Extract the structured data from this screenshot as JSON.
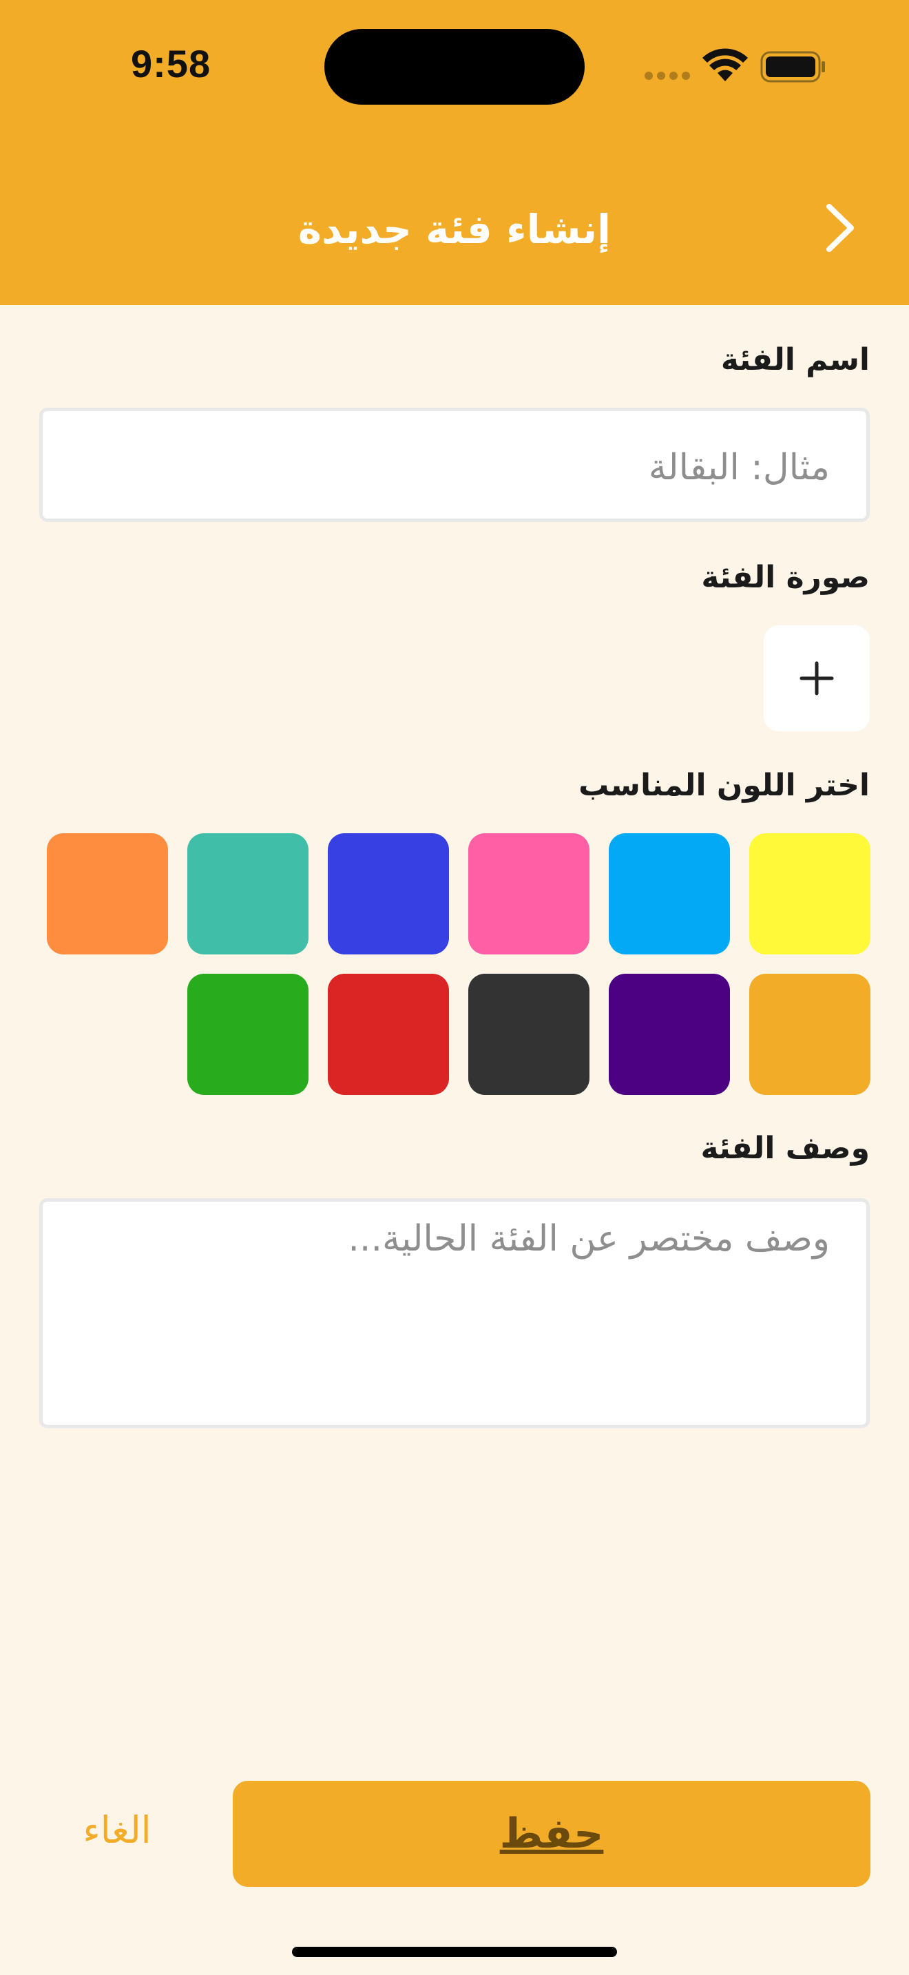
{
  "status_bar": {
    "time": "9:58"
  },
  "header": {
    "title": "إنشاء فئة جديدة",
    "back_icon": "chevron-right-icon"
  },
  "form": {
    "name_label": "اسم الفئة",
    "name_placeholder": "مثال: البقالة",
    "image_label": "صورة الفئة",
    "add_image_icon": "plus-icon",
    "color_label": "اختر اللون المناسب",
    "colors": {
      "row1": [
        "#FFF93A",
        "#03A9F5",
        "#FF5FA5",
        "#3740E2",
        "#41BEA8",
        "#FF8D3F"
      ],
      "row2": [
        "#F2AC27",
        "#4B0182",
        "#333333",
        "#DB2424",
        "#28AC1D"
      ]
    },
    "description_label": "وصف الفئة",
    "description_placeholder": "وصف مختصر عن الفئة الحالية..."
  },
  "footer": {
    "save_label": "حفظ",
    "cancel_label": "الغاء"
  },
  "theme": {
    "accent": "#F2AC27",
    "background": "#FDF5E8"
  }
}
